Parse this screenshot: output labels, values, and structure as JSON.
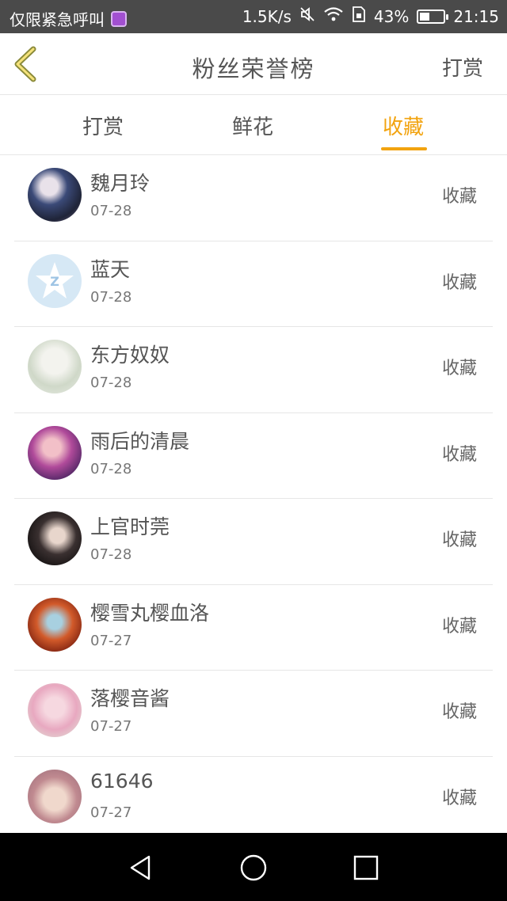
{
  "status_bar": {
    "left_text": "仅限紧急呼叫",
    "speed": "1.5K/s",
    "battery": "43%",
    "battery_level": 0.43,
    "time": "21:15"
  },
  "header": {
    "title": "粉丝荣誉榜",
    "right_action": "打赏"
  },
  "tabs": [
    {
      "label": "打赏",
      "active": false
    },
    {
      "label": "鲜花",
      "active": false
    },
    {
      "label": "收藏",
      "active": true
    }
  ],
  "colors": {
    "accent": "#f2a30f",
    "text": "#555555",
    "divider": "#e6e6e6"
  },
  "fans": [
    {
      "name": "魏月玲",
      "date": "07-28",
      "action": "收藏"
    },
    {
      "name": "蓝天",
      "date": "07-28",
      "action": "收藏"
    },
    {
      "name": "东方奴奴",
      "date": "07-28",
      "action": "收藏"
    },
    {
      "name": "雨后的清晨",
      "date": "07-28",
      "action": "收藏"
    },
    {
      "name": "上官时莞",
      "date": "07-28",
      "action": "收藏"
    },
    {
      "name": "樱雪丸樱血洛",
      "date": "07-27",
      "action": "收藏"
    },
    {
      "name": "落樱音酱",
      "date": "07-27",
      "action": "收藏"
    },
    {
      "name": "61646",
      "date": "07-27",
      "action": "收藏"
    }
  ]
}
